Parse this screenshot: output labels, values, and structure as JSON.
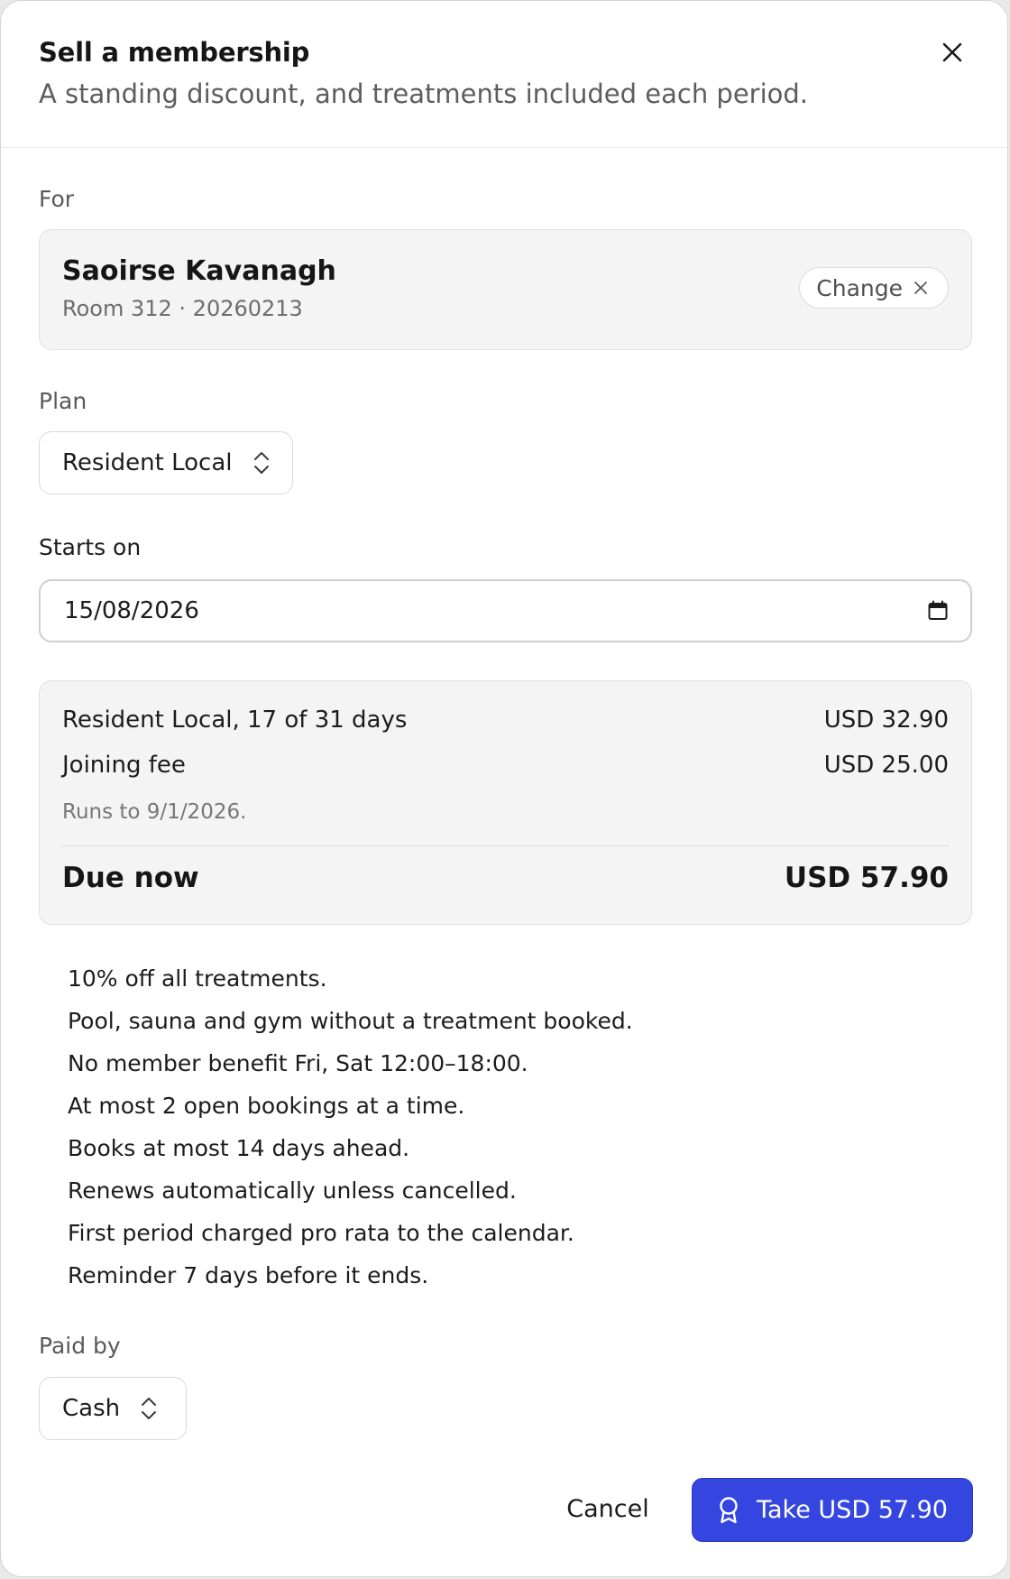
{
  "dialog": {
    "title": "Sell a membership",
    "subtitle": "A standing discount, and treatments included each period."
  },
  "customer": {
    "section_label": "For",
    "name": "Saoirse Kavanagh",
    "meta": "Room 312 · 20260213",
    "change_label": "Change"
  },
  "plan": {
    "section_label": "Plan",
    "selected": "Resident Local"
  },
  "start": {
    "section_label": "Starts on",
    "value": "15/08/2026"
  },
  "summary": {
    "lines": [
      {
        "label": "Resident Local, 17 of 31 days",
        "amount": "USD 32.90"
      },
      {
        "label": "Joining fee",
        "amount": "USD 25.00"
      }
    ],
    "runs_note": "Runs to 9/1/2026.",
    "due_label": "Due now",
    "due_amount": "USD 57.90"
  },
  "benefits": [
    "10% off all treatments.",
    "Pool, sauna and gym without a treatment booked.",
    "No member benefit Fri, Sat 12:00–18:00.",
    "At most 2 open bookings at a time.",
    "Books at most 14 days ahead.",
    "Renews automatically unless cancelled.",
    "First period charged pro rata to the calendar.",
    "Reminder 7 days before it ends."
  ],
  "payment": {
    "section_label": "Paid by",
    "selected": "Cash"
  },
  "actions": {
    "cancel_label": "Cancel",
    "confirm_label": "Take USD 57.90"
  },
  "icons": {
    "close": "close-icon",
    "change_clear": "close-icon",
    "select_chevrons": "chevron-up-down-icon",
    "calendar": "calendar-icon",
    "confirm": "award-ribbon-icon"
  },
  "colors": {
    "primary": "#3546e0",
    "card_bg": "#f4f4f4",
    "muted_text": "#5d5d5d"
  }
}
